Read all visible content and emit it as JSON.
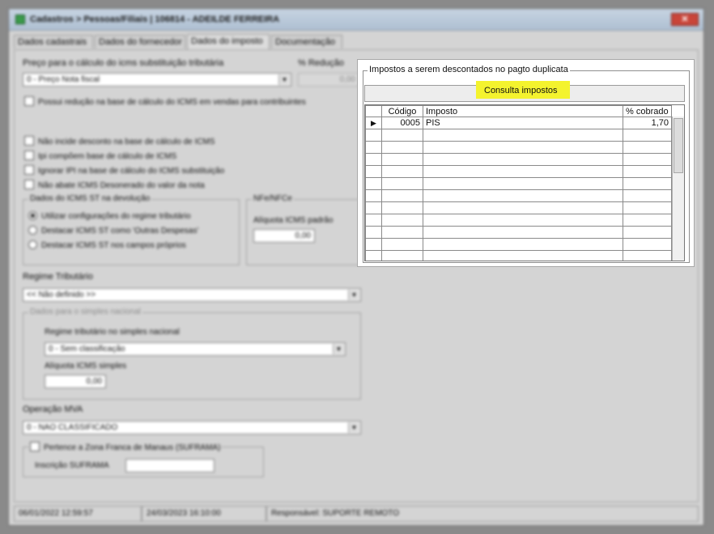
{
  "window": {
    "title": "Cadastros > Pessoas/Filiais | 106814 - ADEILDE FERREIRA",
    "close_label": "✕"
  },
  "tabs": [
    "Dados cadastrais",
    "Dados do fornecedor",
    "Dados do imposto",
    "Documentação"
  ],
  "form": {
    "preco_label": "Preço para o cálculo do icms substituição tributária",
    "preco_value": "0 - Preço Nota fiscal",
    "reducao_label": "% Redução",
    "reducao_value": "0,00",
    "possui_reducao": "Possui redução na base de cálculo do ICMS em vendas para contribuintes",
    "checks": [
      "Não incide desconto na base de cálculo de ICMS",
      "Ipi compõem base de cálculo de ICMS",
      "Ignorar IPI na base de cálculo do ICMS substituição",
      "Não abate ICMS Desonerado do valor da nota"
    ],
    "devolucao_legend": "Dados do ICMS ST na devolução",
    "radios": [
      "Utilizar configurações do regime tributário",
      "Destacar ICMS ST como 'Outras Despesas'",
      "Destacar ICMS ST nos campos próprios"
    ],
    "nfe_legend": "NFe/NFCe",
    "aliquota_padrao_label": "Alíquota ICMS padrão",
    "aliquota_padrao_value": "0,00",
    "regime_label": "Regime Tributário",
    "regime_value": "<< Não definido >>",
    "simples_legend": "Dados para o simples nacional",
    "regime_simples_label": "Regime tributário no simples nacional",
    "regime_simples_value": "0 - Sem classificação",
    "aliquota_simples_label": "Alíquota ICMS simples",
    "aliquota_simples_value": "0,00",
    "operacao_label": "Operação MVA",
    "operacao_value": "0 - NAO CLASSIFICADO",
    "suframa_legend": "Pertence a Zona Franca de Manaus (SUFRAMA)",
    "suframa_inscricao_label": "Inscrição SUFRAMA",
    "suframa_inscricao_value": ""
  },
  "impostos": {
    "legend": "Impostos a serem descontados no pagto duplicata",
    "button_label": "Consulta impostos",
    "headers": [
      "Código",
      "Imposto",
      "% cobrado"
    ],
    "rows": [
      {
        "codigo": "0005",
        "imposto": "PIS",
        "cobrado": "1,70"
      }
    ],
    "indicator": "▶"
  },
  "status": {
    "created": "06/01/2022 12:59:57",
    "updated": "24/03/2023 16:10:00",
    "responsavel": "Responsável: SUPORTE REMOTO"
  },
  "colors": {
    "highlight": "#f4f32e",
    "window_bg": "#d4d4d4",
    "title_close": "#c9453a"
  }
}
